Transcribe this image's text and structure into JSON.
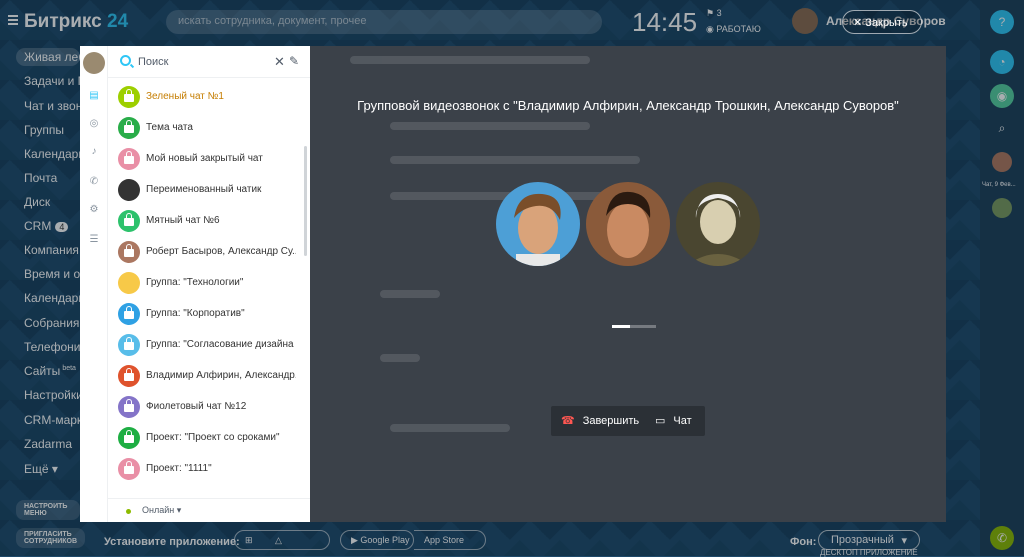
{
  "header": {
    "logo": "Битрикс",
    "logo_num": "24",
    "search_placeholder": "искать сотрудника, документ, прочее",
    "clock": "14:45",
    "flag_count": "3",
    "work_status": "РАБОТАЮ",
    "user_name": "Александр Суворов"
  },
  "left_menu": {
    "items": [
      "Живая лента",
      "Задачи и Проекты",
      "Чат и звонки",
      "Группы",
      "Календарь",
      "Почта",
      "Диск",
      "CRM",
      "Компания",
      "Время и отчёты",
      "Календарь",
      "Собрания и",
      "Телефония",
      "Сайты",
      "Настройки",
      "CRM-маркетинг",
      "Zadarma",
      "Ещё"
    ],
    "crm_badge": "4",
    "sites_badge": "beta",
    "setup_btn": "НАСТРОИТЬ МЕНЮ",
    "invite_btn": "ПРИГЛАСИТЬ СОТРУДНИКОВ"
  },
  "call": {
    "title": "Групповой видеозвонок с \"Владимир Алфирин, Александр Трошкин, Александр Суворов\"",
    "end_label": "Завершить",
    "chat_label": "Чат",
    "close_label": "Закрыть",
    "loading_progress": 0.4
  },
  "messenger": {
    "search_label": "Поиск",
    "chats": [
      {
        "name": "Зеленый чат №1",
        "color": "#9dcf00",
        "highlight": true
      },
      {
        "name": "Тема чата",
        "color": "#29ad49"
      },
      {
        "name": "Мой новый закрытый чат",
        "color": "#e98fa6"
      },
      {
        "name": "Переименованный чатик",
        "color": "#333333",
        "photo": true
      },
      {
        "name": "Мятный чат №6",
        "color": "#2dc26c"
      },
      {
        "name": "Роберт Басыров, Александр Су...",
        "color": "#ab7761"
      },
      {
        "name": "Группа: \"Технологии\"",
        "color": "#f7c948",
        "photo": true
      },
      {
        "name": "Группа: \"Корпоратив\"",
        "color": "#2fa1e4"
      },
      {
        "name": "Группа: \"Согласование дизайна ...",
        "color": "#58bde9"
      },
      {
        "name": "Владимир Алфирин, Александр...",
        "color": "#df532d"
      },
      {
        "name": "Фиолетовый чат №12",
        "color": "#8474c8"
      },
      {
        "name": "Проект: \"Проект со сроками\"",
        "color": "#1eae43"
      },
      {
        "name": "Проект: \"1111\"",
        "color": "#e98fa6"
      }
    ],
    "status": "Онлайн"
  },
  "bottom": {
    "install_label": "Установите приложение:",
    "google_play": "Google Play",
    "app_store": "App Store",
    "bg_label": "Фон:",
    "bg_value": "Прозрачный",
    "desktop_app": "ДЕСКТОП ПРИЛОЖЕНИЕ"
  },
  "right_bar": {
    "user_label": "Чат, 9 Фев..."
  }
}
